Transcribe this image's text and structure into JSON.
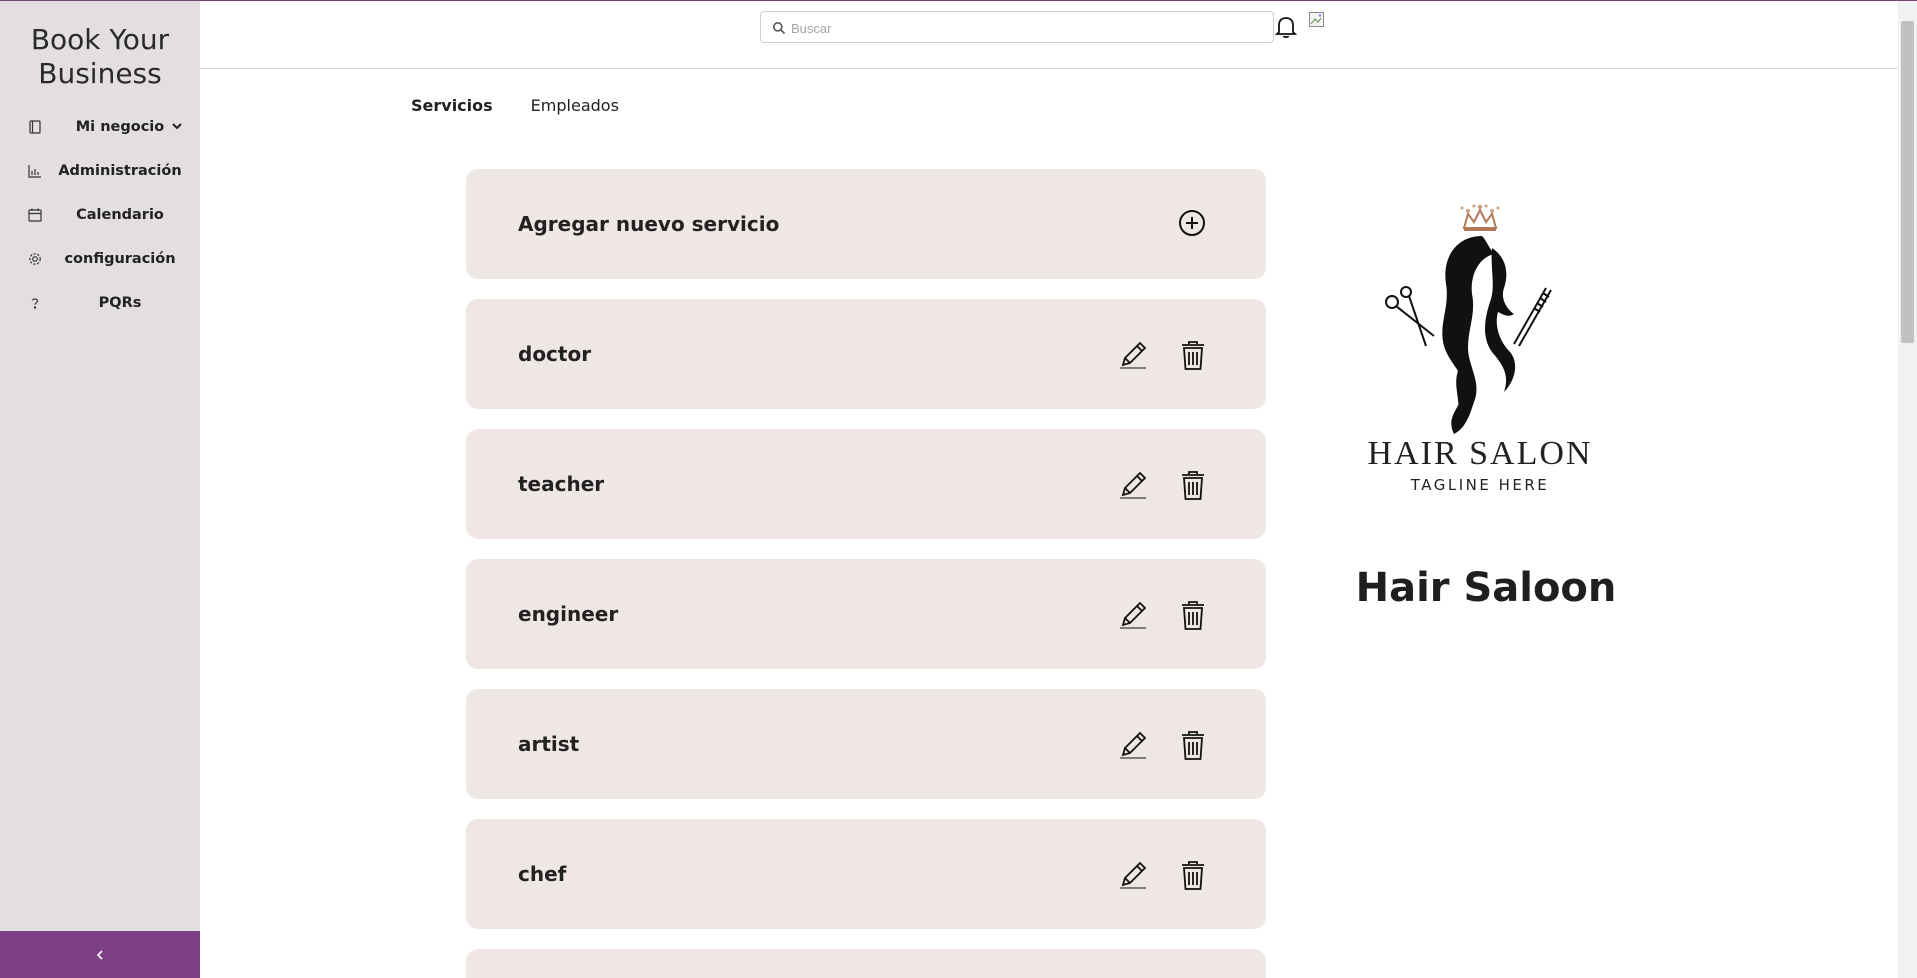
{
  "app": {
    "brand_title": "Book Your Business"
  },
  "sidebar": {
    "items": [
      {
        "label": "Mi negocio",
        "icon": "book-icon",
        "has_dropdown": true
      },
      {
        "label": "Administración",
        "icon": "bar-chart-icon"
      },
      {
        "label": "Calendario",
        "icon": "calendar-icon"
      },
      {
        "label": "configuración",
        "icon": "gear-icon"
      },
      {
        "label": "PQRs",
        "icon": "question-icon"
      }
    ],
    "collapse_icon": "chevron-left-icon"
  },
  "header": {
    "search": {
      "placeholder": "Buscar",
      "value": ""
    },
    "notifications_icon": "bell-icon",
    "avatar_icon": "broken-image-icon"
  },
  "tabs": [
    {
      "label": "Servicios",
      "active": true
    },
    {
      "label": "Empleados",
      "active": false
    }
  ],
  "services": {
    "add_label": "Agregar nuevo servicio",
    "add_icon": "plus-circle-icon",
    "items": [
      {
        "name": "doctor"
      },
      {
        "name": "teacher"
      },
      {
        "name": "engineer"
      },
      {
        "name": "artist"
      },
      {
        "name": "chef"
      },
      {
        "name": ""
      }
    ],
    "edit_icon": "pencil-icon",
    "delete_icon": "trash-icon"
  },
  "business": {
    "logo_text": "HAIR SALON",
    "logo_tagline": "TAGLINE HERE",
    "name": "Hair Saloon"
  },
  "colors": {
    "sidebar_bg": "#e2dfde",
    "accent_purple": "#7d3f84",
    "card_bg": "#efe7e4"
  }
}
